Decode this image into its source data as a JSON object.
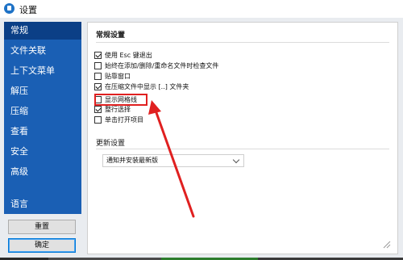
{
  "window": {
    "title": "设置"
  },
  "sidebar": {
    "items": [
      {
        "label": "常规"
      },
      {
        "label": "文件关联"
      },
      {
        "label": "上下文菜单"
      },
      {
        "label": "解压"
      },
      {
        "label": "压缩"
      },
      {
        "label": "查看"
      },
      {
        "label": "安全"
      },
      {
        "label": "高级"
      },
      {
        "label": "语言"
      }
    ],
    "reset_label": "重置",
    "ok_label": "确定"
  },
  "general": {
    "title": "常规设置",
    "options": [
      {
        "label": "使用 Esc 键退出",
        "checked": true
      },
      {
        "label": "始终在添加/删除/重命名文件时检查文件",
        "checked": false
      },
      {
        "label": "贴靠窗口",
        "checked": false
      },
      {
        "label": "在压缩文件中显示 [..] 文件夹",
        "checked": true
      },
      {
        "label": "显示网格线",
        "checked": false
      },
      {
        "label": "整行选择",
        "checked": true
      },
      {
        "label": "单击打开项目",
        "checked": false
      }
    ]
  },
  "update": {
    "title": "更新设置",
    "selected": "通知并安装最新版"
  },
  "colors": {
    "accent": "#1a5fb4",
    "active": "#0b3f86",
    "annotation": "#e02020"
  }
}
